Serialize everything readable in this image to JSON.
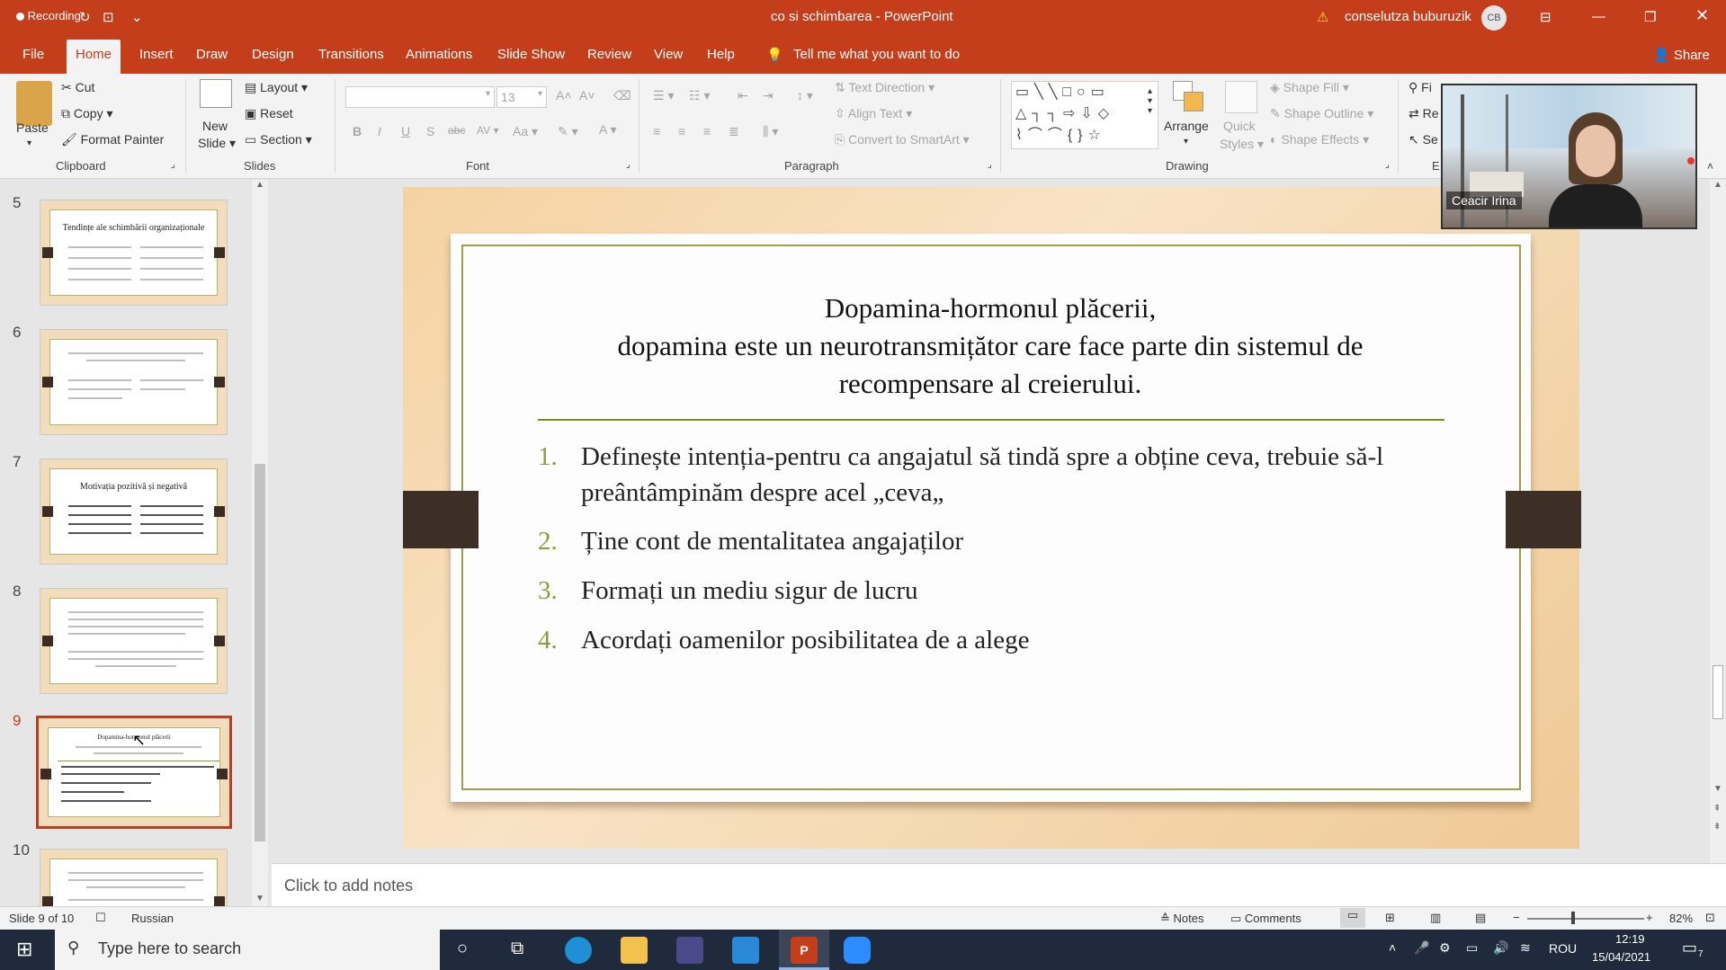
{
  "window": {
    "recording_label": "Recording",
    "title": "co si schimbarea  -  PowerPoint",
    "user": "conselutza buburuzik",
    "user_initials": "CB"
  },
  "tabs": [
    "File",
    "Home",
    "Insert",
    "Draw",
    "Design",
    "Transitions",
    "Animations",
    "Slide Show",
    "Review",
    "View",
    "Help"
  ],
  "tell_me": "Tell me what you want to do",
  "share_label": "Share",
  "ribbon": {
    "clipboard": {
      "paste": "Paste",
      "cut": "Cut",
      "copy": "Copy",
      "format_painter": "Format Painter",
      "label": "Clipboard"
    },
    "slides": {
      "new_slide_1": "New",
      "new_slide_2": "Slide",
      "layout": "Layout",
      "reset": "Reset",
      "section": "Section",
      "label": "Slides"
    },
    "font": {
      "size": "13",
      "label": "Font"
    },
    "paragraph": {
      "text_direction": "Text Direction",
      "align_text": "Align Text",
      "convert_smartart": "Convert to SmartArt",
      "label": "Paragraph"
    },
    "drawing": {
      "arrange": "Arrange",
      "quick_styles_1": "Quick",
      "quick_styles_2": "Styles",
      "shape_fill": "Shape Fill",
      "shape_outline": "Shape Outline",
      "shape_effects": "Shape Effects",
      "label": "Drawing"
    },
    "editing": {
      "find": "Fi",
      "replace": "Re",
      "select": "Se",
      "label": "E"
    }
  },
  "thumbnails": [
    {
      "num": "5",
      "title": "Tendințe ale schimbării organizaționale"
    },
    {
      "num": "6",
      "title": ""
    },
    {
      "num": "7",
      "title": "Motivația pozitivă și negativă"
    },
    {
      "num": "8",
      "title": ""
    },
    {
      "num": "9",
      "title": "Dopamina-hormonul plăcerii"
    },
    {
      "num": "10",
      "title": ""
    }
  ],
  "slide": {
    "title_line1": "Dopamina-hormonul plăcerii,",
    "title_line2": "dopamina este un neurotransmițător care face parte din sistemul de",
    "title_line3": "recompensare al creierului.",
    "items": [
      {
        "n": "1.",
        "text": "Definește intenția-pentru ca angajatul să tindă spre a obține ceva, trebuie să-l preântâmpinăm despre acel „ceva„"
      },
      {
        "n": "2.",
        "text": "Ține cont de mentalitatea angajaților"
      },
      {
        "n": "3.",
        "text": "Formați un mediu sigur de lucru"
      },
      {
        "n": "4.",
        "text": "Acordați oamenilor posibilitatea de a alege"
      }
    ]
  },
  "notes_placeholder": "Click to add notes",
  "status": {
    "slide_of": "Slide 9 of 10",
    "language": "Russian",
    "notes": "Notes",
    "comments": "Comments",
    "zoom": "82%"
  },
  "video": {
    "name": "Ceacir Irina"
  },
  "taskbar": {
    "search_placeholder": "Type here to search",
    "lang": "ROU",
    "time": "12:19",
    "date": "15/04/2021",
    "notifications": "7"
  },
  "colors": {
    "accent": "#c43e1c",
    "slide_bg": "#f5d2a2",
    "list_number": "#8f9a3c"
  }
}
